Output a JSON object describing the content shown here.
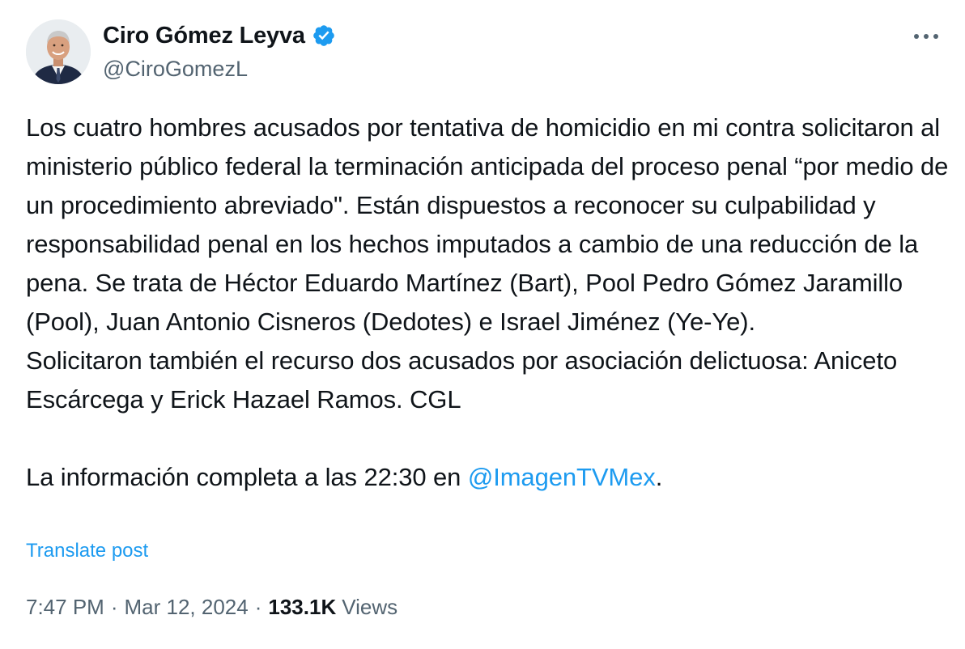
{
  "author": {
    "display_name": "Ciro Gómez Leyva",
    "handle": "@CiroGomezL",
    "verified_icon": "verified-badge-icon"
  },
  "tweet": {
    "text_before": "Los cuatro hombres acusados por tentativa de homicidio en mi contra solicitaron al ministerio público federal la terminación anticipada del proceso penal “por medio de un procedimiento abreviado\". Están dispuestos a reconocer su culpabilidad y responsabilidad penal en los hechos imputados a cambio de una reducción de la pena. Se trata de Héctor Eduardo Martínez (Bart), Pool Pedro Gómez Jaramillo (Pool), Juan Antonio Cisneros (Dedotes) e Israel Jiménez (Ye-Ye).\nSolicitaron también el recurso dos acusados por asociación delictuosa: Aniceto Escárcega y Erick Hazael Ramos. CGL\n\nLa información completa a las 22:30 en ",
    "mention": "@ImagenTVMex",
    "text_after": "."
  },
  "translate_label": "Translate post",
  "meta": {
    "time": "7:47 PM",
    "separator": "·",
    "date": "Mar 12, 2024",
    "views_count": "133.1K",
    "views_label": "Views"
  },
  "colors": {
    "link": "#1d9bf0",
    "secondary_text": "#536471",
    "primary_text": "#0f1419"
  }
}
